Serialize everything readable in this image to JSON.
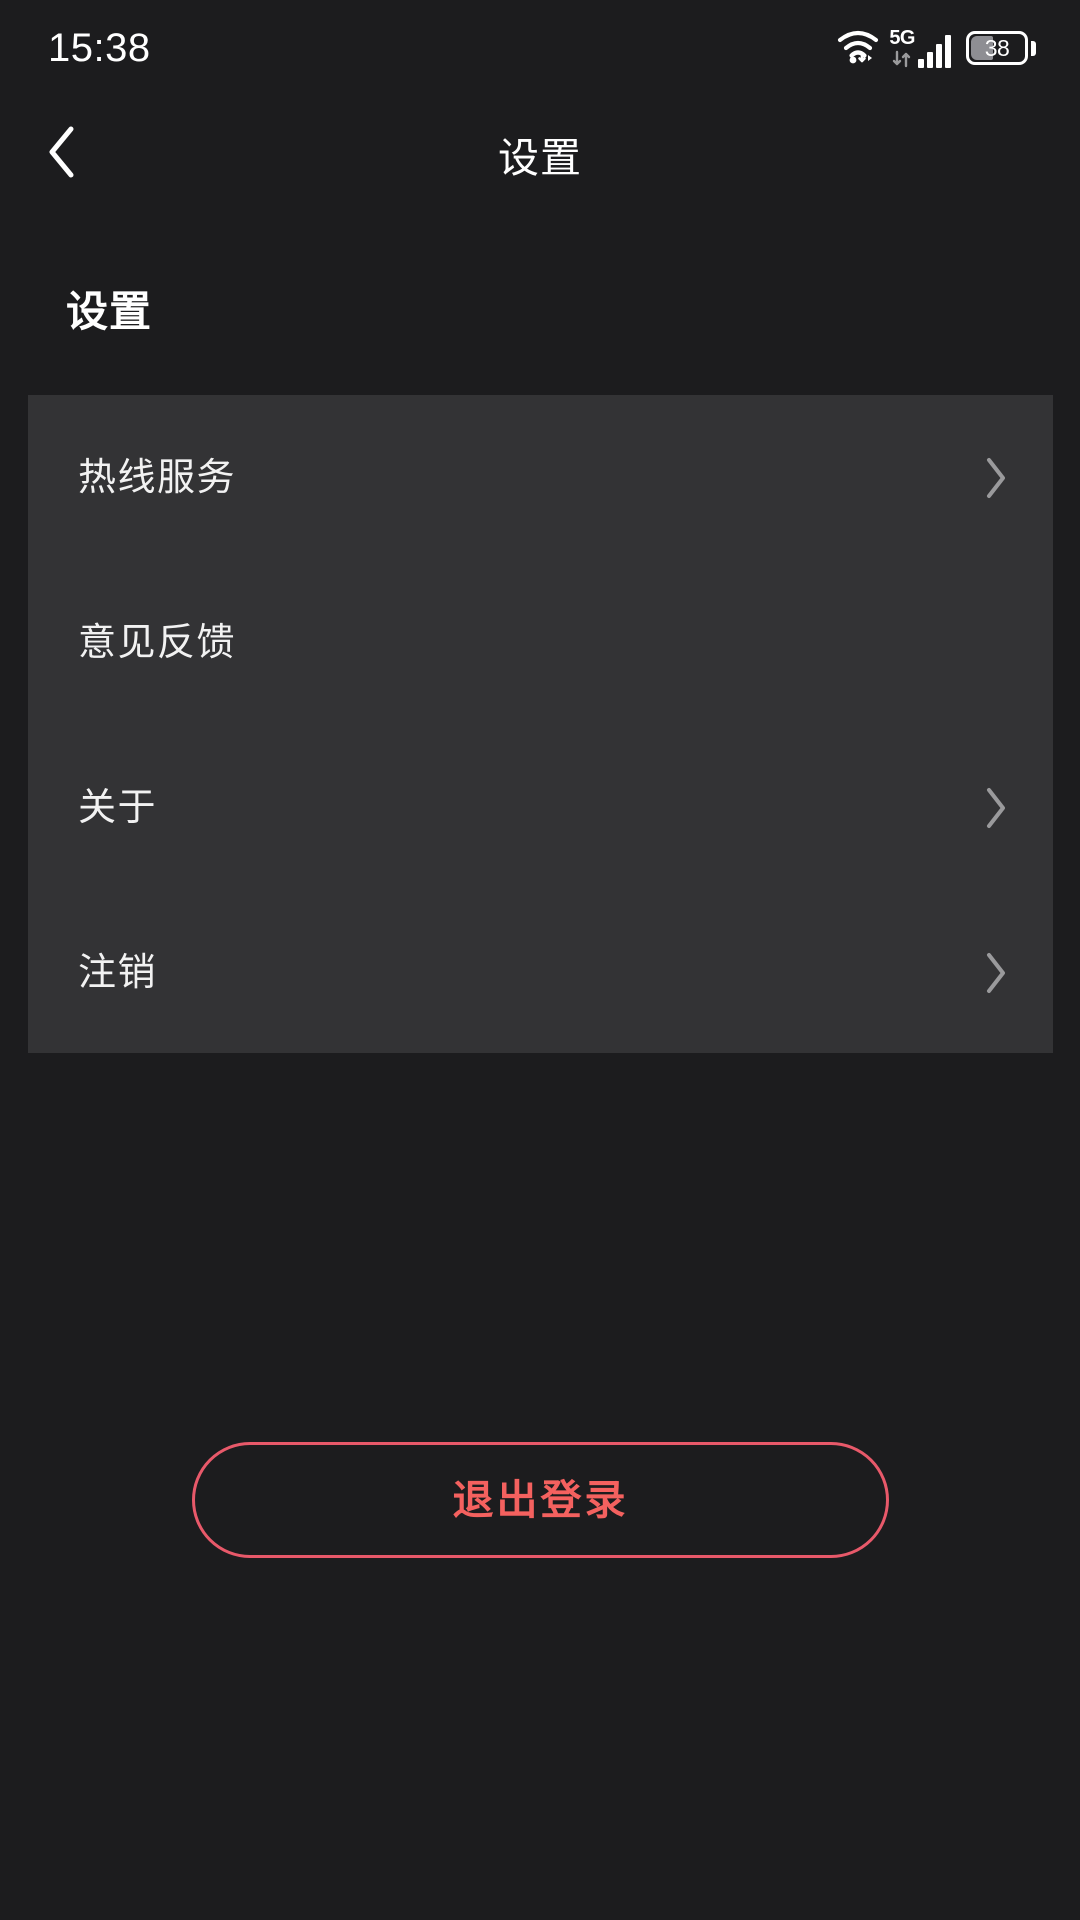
{
  "status_bar": {
    "time": "15:38",
    "network_type": "5G",
    "battery_level": "38",
    "wifi_icon": "wifi-icon",
    "signal_icon": "cellular-signal-icon",
    "battery_icon": "battery-icon"
  },
  "nav": {
    "back_icon": "chevron-left-icon",
    "title": "设置"
  },
  "section": {
    "header": "设置"
  },
  "settings_list": {
    "items": [
      {
        "label": "热线服务",
        "has_chevron": true,
        "icon": "chevron-right-icon"
      },
      {
        "label": "意见反馈",
        "has_chevron": false,
        "icon": ""
      },
      {
        "label": "关于",
        "has_chevron": true,
        "icon": "chevron-right-icon"
      },
      {
        "label": "注销",
        "has_chevron": true,
        "icon": "chevron-right-icon"
      }
    ]
  },
  "logout": {
    "label": "退出登录"
  },
  "colors": {
    "page_background": "#1c1c1e",
    "card_background": "#333335",
    "primary_text": "#ffffff",
    "row_text": "#f2f2f2",
    "chevron": "#9a9a9c",
    "danger_border": "#e8596a",
    "danger_text": "#f4615f"
  }
}
